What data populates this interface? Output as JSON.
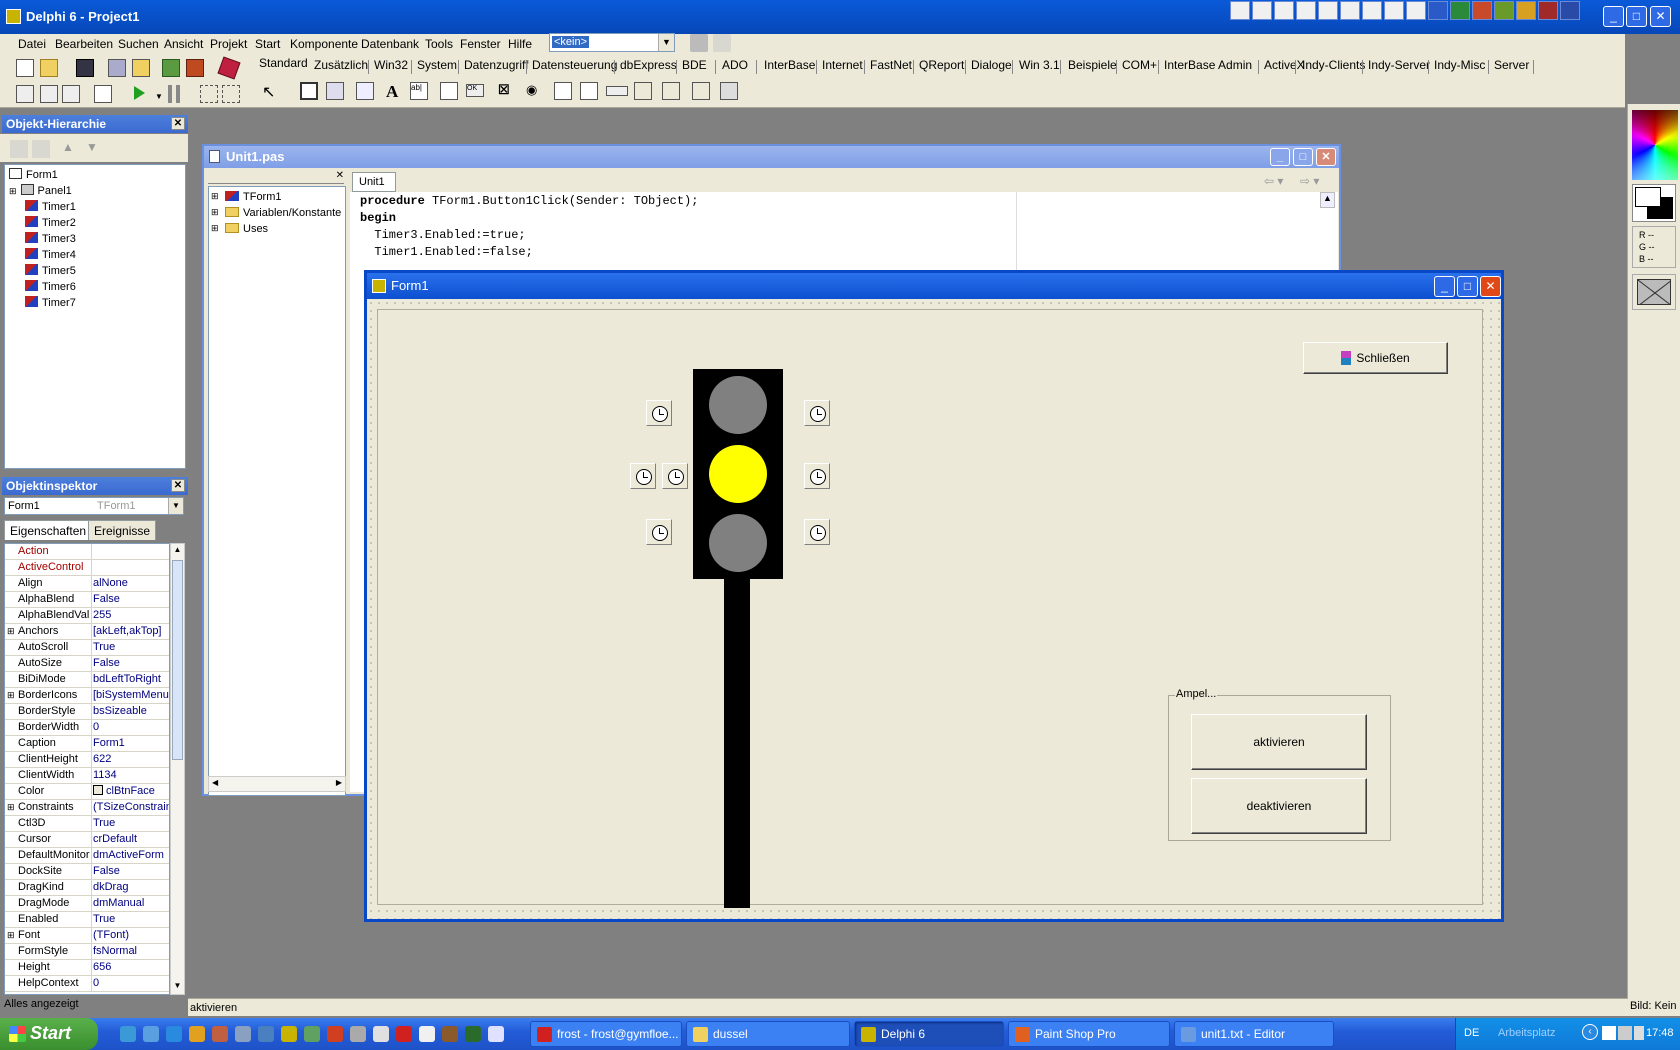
{
  "ide": {
    "title": "Delphi 6 - Project1",
    "menu": [
      "Datei",
      "Bearbeiten",
      "Suchen",
      "Ansicht",
      "Projekt",
      "Start",
      "Komponente",
      "Datenbank",
      "Tools",
      "Fenster",
      "Hilfe"
    ],
    "config_combo": "<kein>",
    "palette_tabs": [
      "Standard",
      "Zusätzlich",
      "Win32",
      "System",
      "Datenzugriff",
      "Datensteuerung",
      "dbExpress",
      "BDE",
      "ADO",
      "InterBase",
      "Internet",
      "FastNet",
      "QReport",
      "Dialoge",
      "Win 3.1",
      "Beispiele",
      "COM+",
      "InterBase Admin",
      "ActiveX",
      "Indy-Clients",
      "Indy-Server",
      "Indy-Misc",
      "Server"
    ],
    "active_palette_tab": "Standard",
    "status_text": "aktivieren"
  },
  "object_tree": {
    "title": "Objekt-Hierarchie",
    "items": [
      "Form1",
      "Panel1",
      "Timer1",
      "Timer2",
      "Timer3",
      "Timer4",
      "Timer5",
      "Timer6",
      "Timer7"
    ]
  },
  "inspector": {
    "title": "Objektinspektor",
    "selected_object": "Form1",
    "selected_type": "TForm1",
    "tabs": [
      "Eigenschaften",
      "Ereignisse"
    ],
    "properties": [
      {
        "name": "Action",
        "value": "",
        "red": true,
        "plus": false
      },
      {
        "name": "ActiveControl",
        "value": "",
        "red": true,
        "plus": false
      },
      {
        "name": "Align",
        "value": "alNone",
        "red": false,
        "plus": false
      },
      {
        "name": "AlphaBlend",
        "value": "False",
        "red": false,
        "plus": false
      },
      {
        "name": "AlphaBlendVal",
        "value": "255",
        "red": false,
        "plus": false
      },
      {
        "name": "Anchors",
        "value": "[akLeft,akTop]",
        "red": false,
        "plus": true
      },
      {
        "name": "AutoScroll",
        "value": "True",
        "red": false,
        "plus": false
      },
      {
        "name": "AutoSize",
        "value": "False",
        "red": false,
        "plus": false
      },
      {
        "name": "BiDiMode",
        "value": "bdLeftToRight",
        "red": false,
        "plus": false
      },
      {
        "name": "BorderIcons",
        "value": "[biSystemMenu,",
        "red": false,
        "plus": true
      },
      {
        "name": "BorderStyle",
        "value": "bsSizeable",
        "red": false,
        "plus": false
      },
      {
        "name": "BorderWidth",
        "value": "0",
        "red": false,
        "plus": false
      },
      {
        "name": "Caption",
        "value": "Form1",
        "red": false,
        "plus": false
      },
      {
        "name": "ClientHeight",
        "value": "622",
        "red": false,
        "plus": false
      },
      {
        "name": "ClientWidth",
        "value": "1134",
        "red": false,
        "plus": false
      },
      {
        "name": "Color",
        "value": "clBtnFace",
        "red": false,
        "plus": false
      },
      {
        "name": "Constraints",
        "value": "(TSizeConstrain",
        "red": false,
        "plus": true
      },
      {
        "name": "Ctl3D",
        "value": "True",
        "red": false,
        "plus": false
      },
      {
        "name": "Cursor",
        "value": "crDefault",
        "red": false,
        "plus": false
      },
      {
        "name": "DefaultMonitor",
        "value": "dmActiveForm",
        "red": false,
        "plus": false
      },
      {
        "name": "DockSite",
        "value": "False",
        "red": false,
        "plus": false
      },
      {
        "name": "DragKind",
        "value": "dkDrag",
        "red": false,
        "plus": false
      },
      {
        "name": "DragMode",
        "value": "dmManual",
        "red": false,
        "plus": false
      },
      {
        "name": "Enabled",
        "value": "True",
        "red": false,
        "plus": false
      },
      {
        "name": "Font",
        "value": "(TFont)",
        "red": false,
        "plus": true
      },
      {
        "name": "FormStyle",
        "value": "fsNormal",
        "red": false,
        "plus": false
      },
      {
        "name": "Height",
        "value": "656",
        "red": false,
        "plus": false
      },
      {
        "name": "HelpContext",
        "value": "0",
        "red": false,
        "plus": false
      }
    ],
    "status": "Alles angezeigt"
  },
  "editor": {
    "title": "Unit1.pas",
    "tab": "Unit1",
    "explorer_items": [
      "TForm1",
      "Variablen/Konstante",
      "Uses"
    ],
    "code_lines": [
      {
        "kw": "procedure",
        "rest": " TForm1.Button1Click(Sender: TObject);"
      },
      {
        "kw": "begin",
        "rest": ""
      },
      {
        "kw": "",
        "rest": "  Timer3.Enabled:=true;"
      },
      {
        "kw": "",
        "rest": "  Timer1.Enabled:=false;"
      }
    ]
  },
  "form1": {
    "title": "Form1",
    "close_button": "Schließen",
    "group_label": "Ampel...",
    "activate_button": "aktivieren",
    "deactivate_button": "deaktivieren",
    "lights": {
      "top": "#808080",
      "middle": "#ffff00",
      "bottom": "#808080"
    }
  },
  "right_panel": {
    "rgb_labels": [
      "R --",
      "G --",
      "B --"
    ],
    "status": "Bild: Kein"
  },
  "taskbar": {
    "start": "Start",
    "tasks": [
      "frost - frost@gymfloe...",
      "dussel",
      "Delphi 6",
      "Paint Shop Pro",
      "unit1.txt - Editor"
    ],
    "active_task": "Delphi 6",
    "language": "DE",
    "desktop_label": "Arbeitsplatz",
    "clock": "17:48"
  }
}
